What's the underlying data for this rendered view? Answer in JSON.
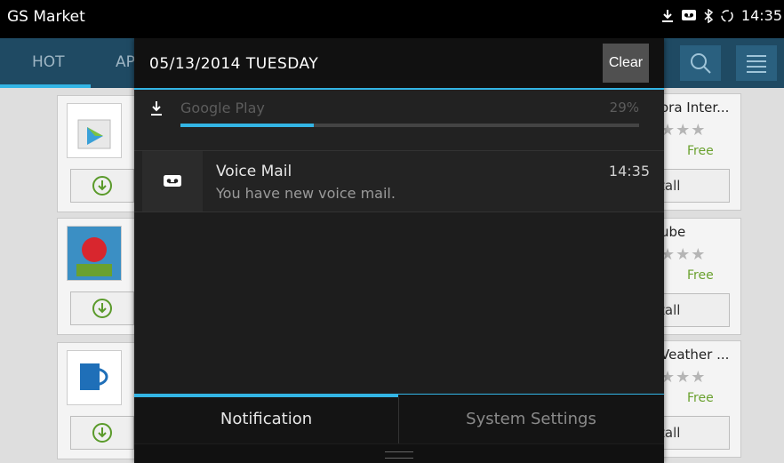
{
  "status_bar": {
    "app_title": "GS Market",
    "time": "14:35",
    "icons": [
      "download-icon",
      "voicemail-icon",
      "bluetooth-icon",
      "sync-icon"
    ]
  },
  "market": {
    "tabs": [
      "HOT",
      "AP"
    ],
    "right_cards": [
      {
        "title": "ora Inter...",
        "stars": "★★★",
        "price": "Free",
        "install_label": "tall"
      },
      {
        "title": "ube",
        "stars": "★★★",
        "price": "Free",
        "install_label": "tall"
      },
      {
        "title": "Veather ...",
        "stars": "★★★",
        "price": "Free",
        "install_label": "tall"
      }
    ]
  },
  "shade": {
    "date": "05/13/2014 TUESDAY",
    "clear_label": "Clear",
    "download": {
      "app": "Google Play",
      "percent_label": "29%",
      "progress": 0.29
    },
    "voicemail": {
      "title": "Voice Mail",
      "time": "14:35",
      "text": "You have new voice mail."
    },
    "tabs": {
      "notification": "Notification",
      "system_settings": "System Settings"
    }
  },
  "colors": {
    "accent": "#33b5e5",
    "appbar": "#1f4a63",
    "shade_bg": "#1d1d1d",
    "free_green": "#6aa12f"
  }
}
